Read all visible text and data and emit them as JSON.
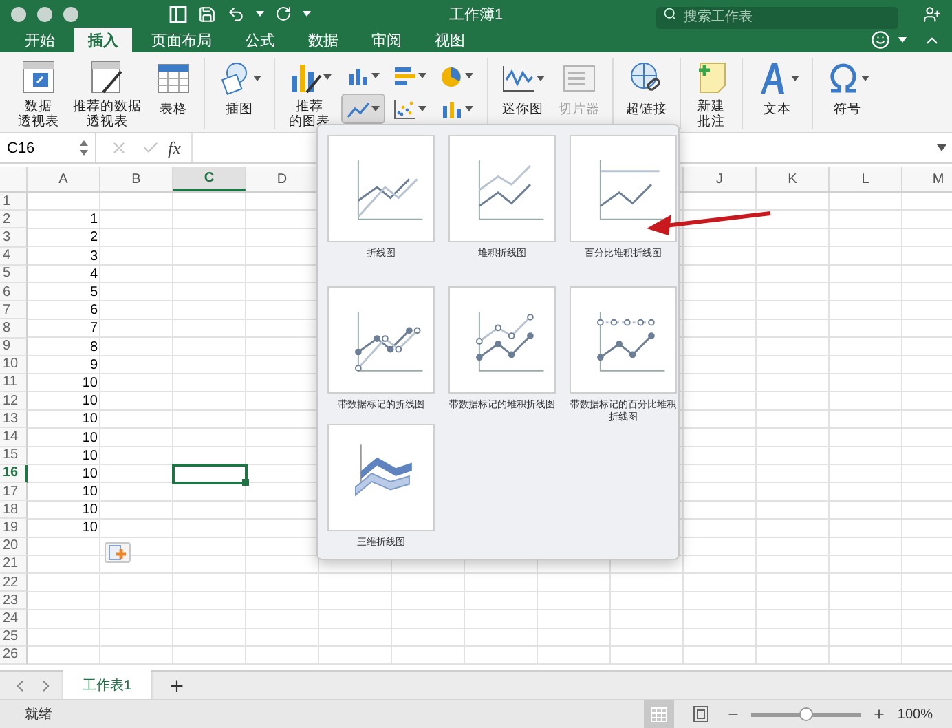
{
  "window": {
    "title": "工作簿1",
    "search": {
      "placeholder": "搜索工作表"
    }
  },
  "tabs": [
    {
      "label": "开始",
      "selected": false
    },
    {
      "label": "插入",
      "selected": true
    },
    {
      "label": "页面布局",
      "selected": false
    },
    {
      "label": "公式",
      "selected": false
    },
    {
      "label": "数据",
      "selected": false
    },
    {
      "label": "审阅",
      "selected": false
    },
    {
      "label": "视图",
      "selected": false
    }
  ],
  "ribbon": [
    [
      {
        "kind": "pivot",
        "label_lines": [
          "数据",
          "透视表"
        ],
        "dropdown": false,
        "disabled": false
      },
      {
        "kind": "recommended_pivot",
        "label_lines": [
          "推荐的数据",
          "透视表"
        ],
        "dropdown": false,
        "disabled": false
      },
      {
        "kind": "table",
        "label_lines": [
          "表格"
        ],
        "dropdown": false,
        "disabled": false
      }
    ],
    [
      {
        "kind": "illustrations",
        "label_lines": [
          "插图"
        ],
        "dropdown": true,
        "disabled": false
      }
    ],
    [
      {
        "kind": "recommended_chart",
        "label_lines": [
          "推荐",
          "的图表"
        ],
        "dropdown": true,
        "disabled": false
      },
      {
        "kind": "chart_grid",
        "buttons": [
          {
            "kind": "column",
            "selected": false
          },
          {
            "kind": "bar",
            "selected": false
          },
          {
            "kind": "pie",
            "selected": false
          },
          {
            "kind": "line",
            "selected": true
          },
          {
            "kind": "scatter",
            "selected": false
          },
          {
            "kind": "stat",
            "selected": false
          }
        ]
      }
    ],
    [
      {
        "kind": "sparkline",
        "label_lines": [
          "迷你图"
        ],
        "dropdown": true,
        "disabled": false
      },
      {
        "kind": "slicer",
        "label_lines": [
          "切片器"
        ],
        "dropdown": false,
        "disabled": true
      }
    ],
    [
      {
        "kind": "hyperlink",
        "label_lines": [
          "超链接"
        ],
        "dropdown": false,
        "disabled": false
      }
    ],
    [
      {
        "kind": "comment",
        "label_lines": [
          "新建",
          "批注"
        ],
        "dropdown": false,
        "disabled": false
      }
    ],
    [
      {
        "kind": "text",
        "label_lines": [
          "文本"
        ],
        "dropdown": true,
        "disabled": false
      }
    ],
    [
      {
        "kind": "symbol",
        "label_lines": [
          "符号"
        ],
        "dropdown": true,
        "disabled": false
      }
    ]
  ],
  "formula_bar": {
    "name_box": "C16",
    "fx": "fx"
  },
  "sheet": {
    "columns_left": [
      {
        "label": "A",
        "selected": false
      },
      {
        "label": "B",
        "selected": false
      },
      {
        "label": "C",
        "selected": true
      },
      {
        "label": "D",
        "selected": false
      }
    ],
    "columns_right": [
      {
        "label": "J",
        "selected": false
      },
      {
        "label": "K",
        "selected": false
      },
      {
        "label": "L",
        "selected": false
      },
      {
        "label": "M",
        "selected": false
      }
    ],
    "rows": [
      {
        "number": "1",
        "selected": false
      },
      {
        "number": "2",
        "a": "1",
        "selected": false
      },
      {
        "number": "3",
        "a": "2",
        "selected": false
      },
      {
        "number": "4",
        "a": "3",
        "selected": false
      },
      {
        "number": "5",
        "a": "4",
        "selected": false
      },
      {
        "number": "6",
        "a": "5",
        "selected": false
      },
      {
        "number": "7",
        "a": "6",
        "selected": false
      },
      {
        "number": "8",
        "a": "7",
        "selected": false
      },
      {
        "number": "9",
        "a": "8",
        "selected": false
      },
      {
        "number": "10",
        "a": "9",
        "selected": false
      },
      {
        "number": "11",
        "a": "10",
        "selected": false
      },
      {
        "number": "12",
        "a": "10",
        "selected": false
      },
      {
        "number": "13",
        "a": "10",
        "selected": false
      },
      {
        "number": "14",
        "a": "10",
        "selected": false
      },
      {
        "number": "15",
        "a": "10",
        "selected": false
      },
      {
        "number": "16",
        "a": "10",
        "selected": true
      },
      {
        "number": "17",
        "a": "10",
        "selected": false
      },
      {
        "number": "18",
        "a": "10",
        "selected": false
      },
      {
        "number": "19",
        "a": "10",
        "selected": false
      },
      {
        "number": "20",
        "selected": false
      },
      {
        "number": "21",
        "selected": false
      },
      {
        "number": "22",
        "selected": false
      },
      {
        "number": "23",
        "selected": false
      },
      {
        "number": "24",
        "selected": false
      },
      {
        "number": "25",
        "selected": false
      },
      {
        "number": "26",
        "selected": false
      }
    ]
  },
  "chart_gallery": {
    "items": [
      {
        "kind": "line",
        "label": "折线图"
      },
      {
        "kind": "stacked",
        "label": "堆积折线图"
      },
      {
        "kind": "percent",
        "label": "百分比堆积折线图"
      },
      {
        "kind": "line_markers",
        "label": "带数据标记的折线图"
      },
      {
        "kind": "stacked_markers",
        "label": "带数据标记的堆积折线图"
      },
      {
        "kind": "percent_markers",
        "label": "带数据标记的百分比堆积折线图"
      },
      {
        "kind": "line_3d",
        "label": "三维折线图"
      }
    ]
  },
  "sheet_tabs": [
    {
      "label": "工作表1",
      "selected": true
    }
  ],
  "status_bar": {
    "text": "就绪",
    "view_buttons": [
      {
        "kind": "normal",
        "selected": true
      },
      {
        "kind": "page_layout",
        "selected": false
      }
    ],
    "zoom": {
      "level": 0.5,
      "reading": "100%"
    }
  }
}
